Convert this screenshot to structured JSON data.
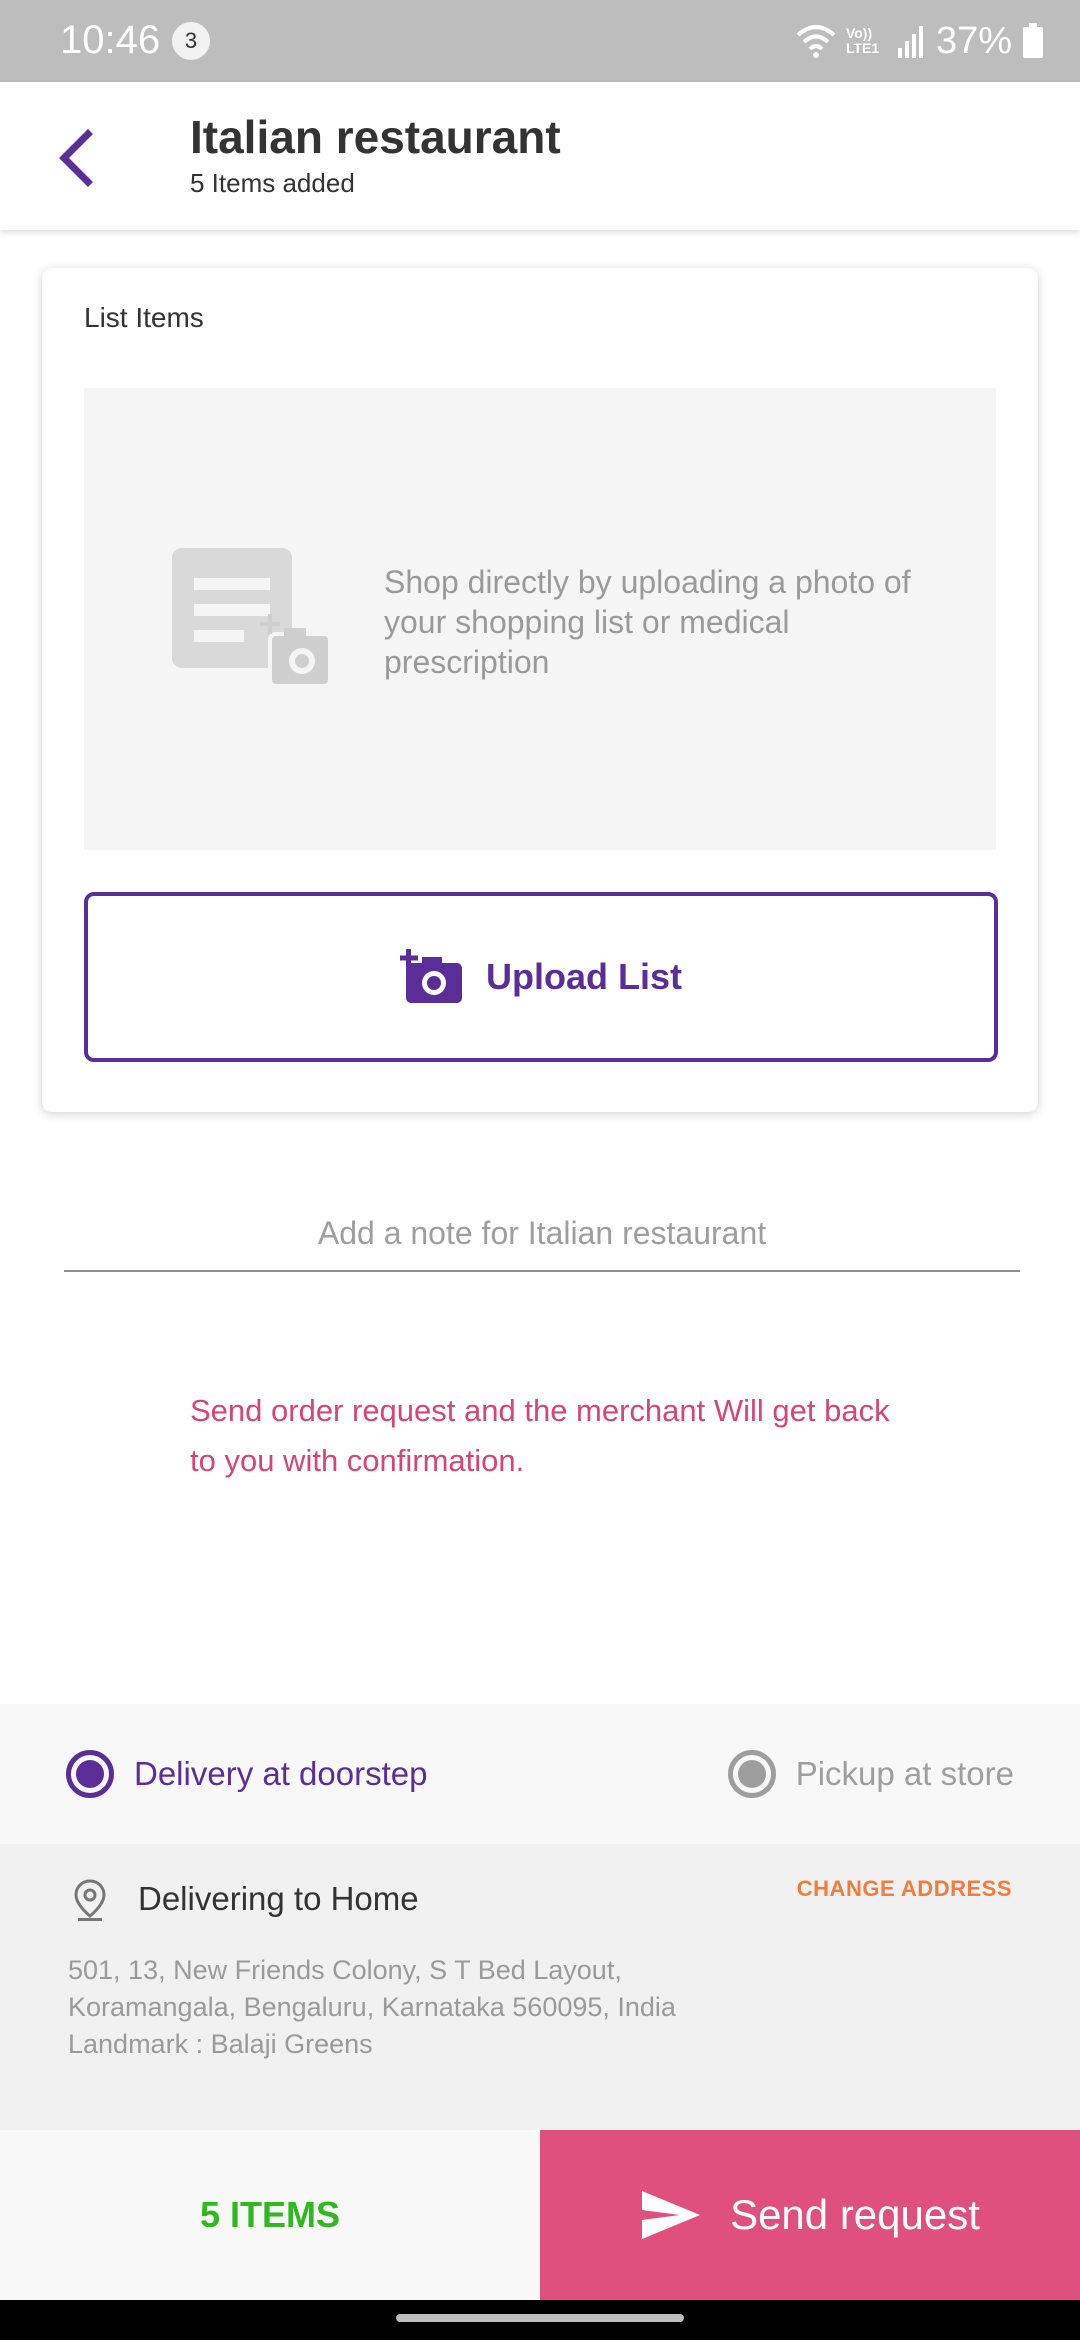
{
  "status_bar": {
    "time": "10:46",
    "notification_count": "3",
    "network_label": "Vo)) LTE1",
    "battery": "37%"
  },
  "app_bar": {
    "title": "Italian restaurant",
    "subtitle": "5 Items added",
    "accent_color": "#5b2e97"
  },
  "list_card": {
    "label": "List Items",
    "placeholder_text": "Shop directly by uploading a photo of your shopping list or medical prescription",
    "upload_button": "Upload List",
    "upload_icon": "add-photo-icon",
    "placeholder_icon": "list-photo-icon"
  },
  "note": {
    "placeholder": "Add a note for Italian restaurant",
    "value": ""
  },
  "info_message": "Send order request and the merchant Will get back to you with confirmation.",
  "fulfillment": {
    "options": [
      {
        "label": "Delivery at doorstep",
        "selected": true
      },
      {
        "label": "Pickup at store",
        "selected": false
      }
    ]
  },
  "address": {
    "heading": "Delivering to Home",
    "change_label": "CHANGE ADDRESS",
    "lines": "501, 13, New Friends Colony, S T Bed Layout, Koramangala, Bengaluru, Karnataka 560095, India",
    "landmark": "Landmark : Balaji Greens"
  },
  "bottom_bar": {
    "items_count": "5 ITEMS",
    "send_label": "Send request",
    "send_color": "#e0507f",
    "items_color": "#2fb81f"
  }
}
